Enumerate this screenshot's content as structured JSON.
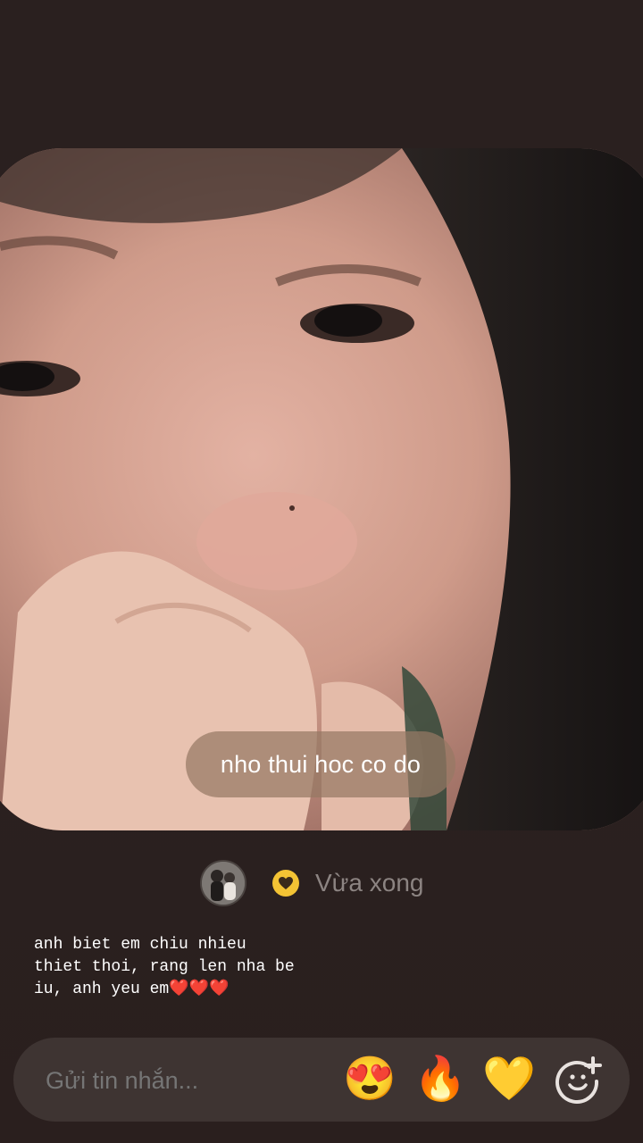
{
  "photo": {
    "caption": "nho thui hoc co do"
  },
  "meta": {
    "timestamp": "Vừa xong"
  },
  "message": {
    "text": "anh biet em chiu nhieu\nthiet thoi, rang len nha be\niu, anh yeu em❤️❤️❤️"
  },
  "reply_bar": {
    "placeholder": "Gửi tin nhắn..."
  },
  "reactions": {
    "heart_eyes": "😍",
    "fire": "🔥",
    "yellow_heart": "💛"
  },
  "colors": {
    "background": "#2a201f",
    "badge_yellow": "#f3c334",
    "reply_bar": "#3e3432"
  }
}
